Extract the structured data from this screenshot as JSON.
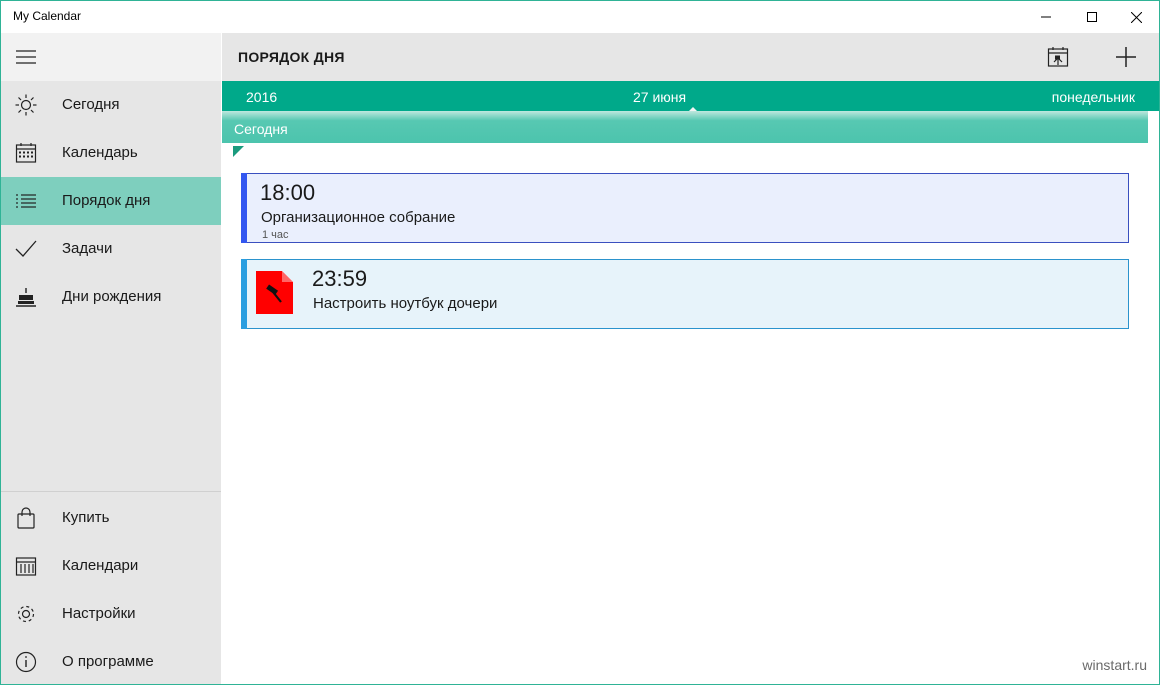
{
  "window": {
    "title": "My Calendar"
  },
  "header": {
    "title": "ПОРЯДОК ДНЯ"
  },
  "sidebar": {
    "top_items": [
      {
        "label": "Сегодня",
        "icon": "sun-icon"
      },
      {
        "label": "Календарь",
        "icon": "calendar-icon"
      },
      {
        "label": "Порядок дня",
        "icon": "list-icon",
        "active": true
      },
      {
        "label": "Задачи",
        "icon": "checkmark-icon"
      },
      {
        "label": "Дни рождения",
        "icon": "cake-icon"
      }
    ],
    "bottom_items": [
      {
        "label": "Купить",
        "icon": "shopping-bag-icon"
      },
      {
        "label": "Календари",
        "icon": "calendars-icon"
      },
      {
        "label": "Настройки",
        "icon": "gear-icon"
      },
      {
        "label": "О программе",
        "icon": "info-icon"
      }
    ]
  },
  "datebar": {
    "year": "2016",
    "day": "27 июня",
    "weekday": "понедельник"
  },
  "today_label": "Сегодня",
  "events": [
    {
      "time": "18:00",
      "title": "Организационное собрание",
      "duration": "1 час",
      "accent": "#3357f0"
    },
    {
      "time": "23:59",
      "title": "Настроить ноутбук дочери",
      "icon": "hammer-task-icon",
      "accent": "#2a9ee0"
    }
  ],
  "watermark": "winstart.ru",
  "colors": {
    "accent": "#00a98a",
    "active_nav": "#7ecfbe",
    "sidebar_bg": "#e6e6e6"
  }
}
